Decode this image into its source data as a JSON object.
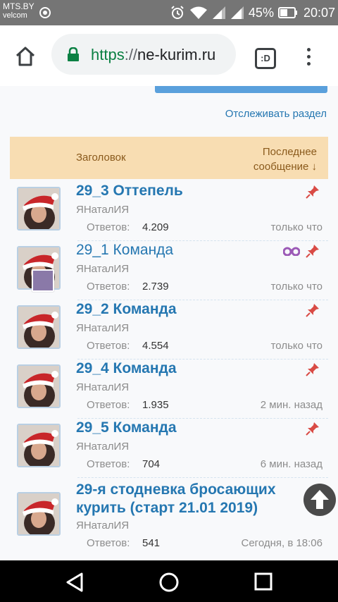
{
  "statusbar": {
    "carrier_main": "MTS.BY",
    "carrier_sub": "velcom",
    "battery_pct": "45%",
    "clock": "20:07"
  },
  "browser": {
    "url_scheme": "https",
    "url_sep": "://",
    "url_host": "ne-kurim.ru",
    "tabs_label": ":D",
    "colors": {
      "secure": "#0b8043"
    }
  },
  "page": {
    "watch_section": "Отслеживать раздел",
    "header": {
      "title_col": "Заголовок",
      "last_col_line1": "Последнее",
      "last_col_line2": "сообщение ↓"
    },
    "replies_label": "Ответов:",
    "threads": [
      {
        "title": "29_3 Оттепель",
        "author": "ЯНаталИЯ",
        "replies": "4.209",
        "last": "только что",
        "icons": [
          "pin-icon"
        ]
      },
      {
        "title": "29_1 Команда",
        "author": "ЯНаталИЯ",
        "replies": "2.739",
        "last": "только что",
        "icons": [
          "watch-icon",
          "pin-icon"
        ]
      },
      {
        "title": "29_2 Команда",
        "author": "ЯНаталИЯ",
        "replies": "4.554",
        "last": "только что",
        "icons": [
          "pin-icon"
        ]
      },
      {
        "title": "29_4 Команда",
        "author": "ЯНаталИЯ",
        "replies": "1.935",
        "last": "2 мин. назад",
        "icons": [
          "pin-icon"
        ]
      },
      {
        "title": "29_5 Команда",
        "author": "ЯНаталИЯ",
        "replies": "704",
        "last": "6 мин. назад",
        "icons": [
          "pin-icon"
        ]
      },
      {
        "title": "29-я стодневка бросающих курить (старт 21.01 2019)",
        "author": "ЯНаталИЯ",
        "replies": "541",
        "last": "Сегодня, в 18:06",
        "icons": []
      }
    ],
    "colors": {
      "link": "#2577b1",
      "header_bg": "#f8ddb2",
      "header_text": "#8a5a1c",
      "pin": "#d94b45"
    }
  }
}
